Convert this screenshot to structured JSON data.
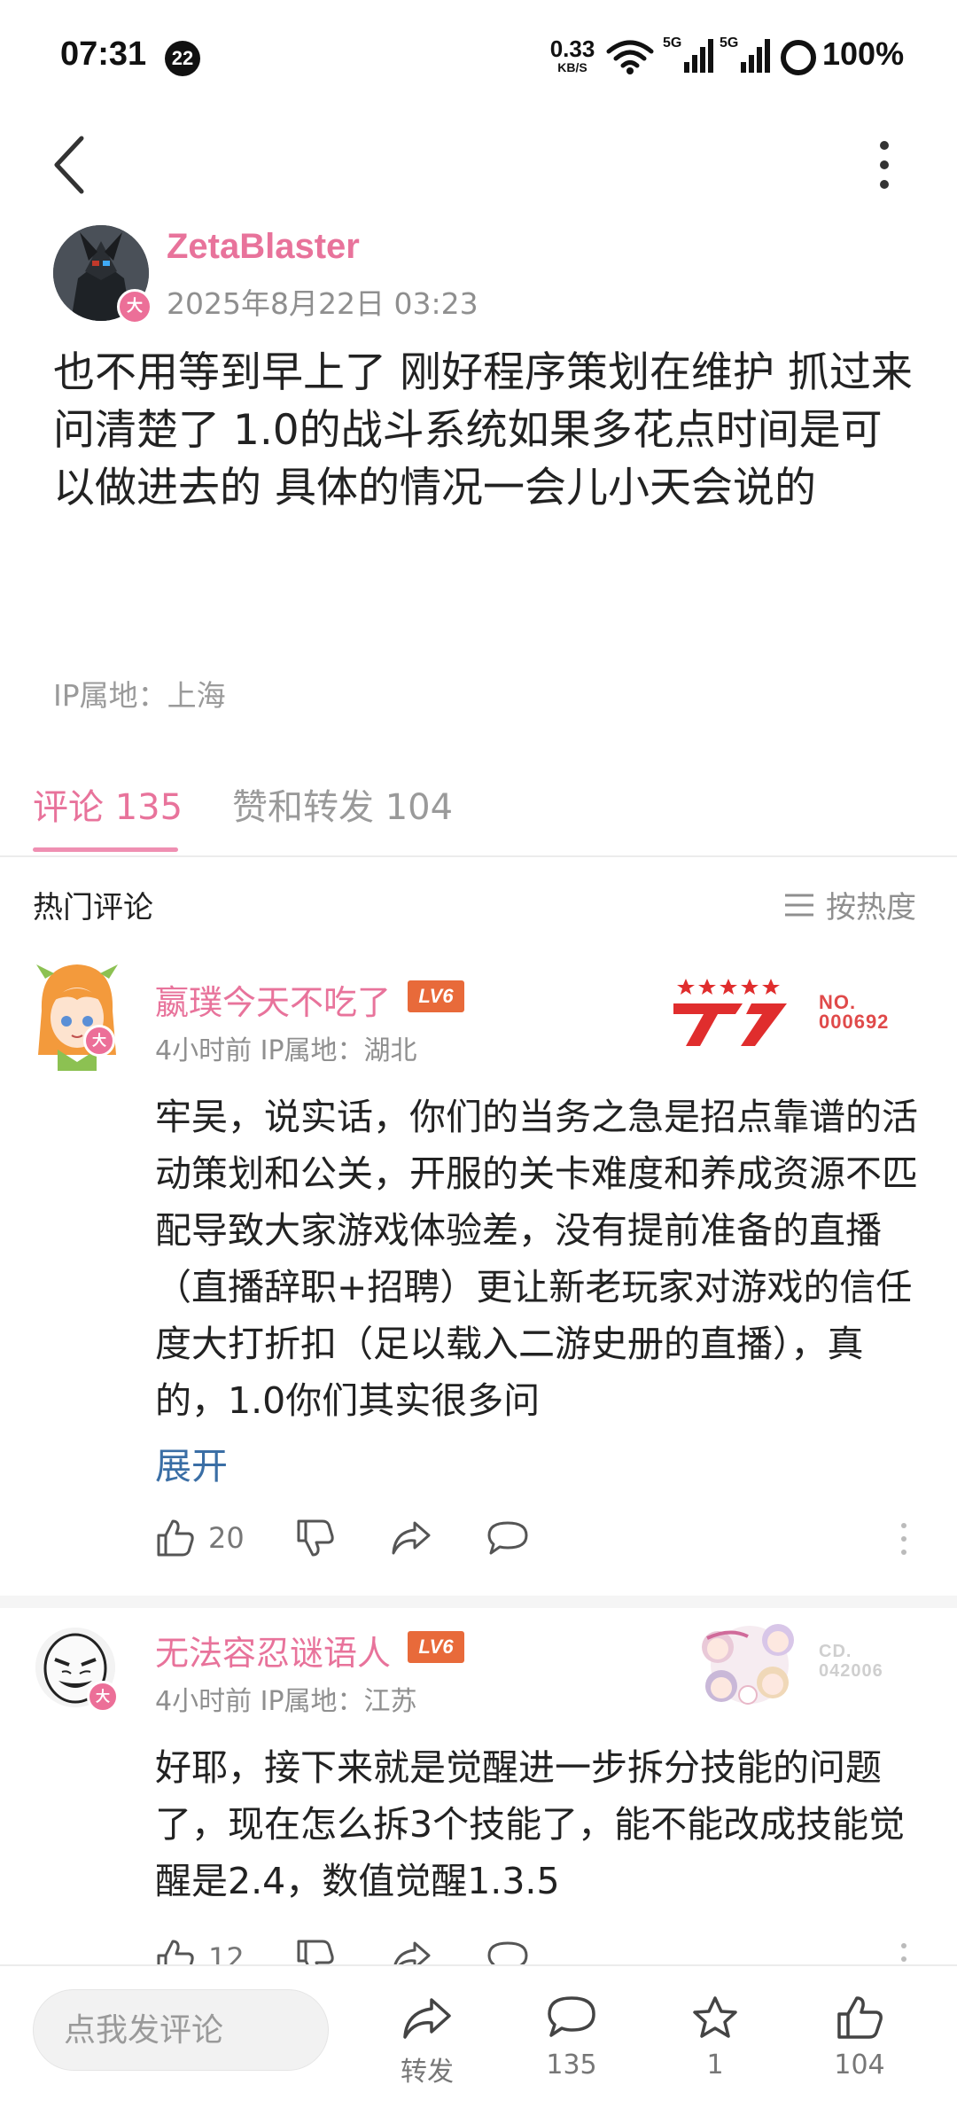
{
  "status_bar": {
    "time": "07:31",
    "notification_count": "22",
    "net_speed_value": "0.33",
    "net_speed_unit": "KB/S",
    "signal_label_1": "5G",
    "signal_label_2": "5G",
    "battery": "100%"
  },
  "post": {
    "author": "ZetaBlaster",
    "level_char": "大",
    "time": "2025年8月22日 03:23",
    "body": "也不用等到早上了 刚好程序策划在维护 抓过来问清楚了 1.0的战斗系统如果多花点时间是可以做进去的 具体的情况一会儿小天会说的",
    "ip": "IP属地：上海"
  },
  "tabs": [
    {
      "label": "评论 135",
      "active": true
    },
    {
      "label": "赞和转发 104",
      "active": false
    }
  ],
  "comments_header": {
    "title": "热门评论",
    "sort_label": "按热度"
  },
  "comments": [
    {
      "name": "嬴璞今天不吃了",
      "level_tag": "LV6",
      "level_char": "大",
      "meta": "4小时前 IP属地：湖北",
      "badge_label": "NO.",
      "badge_number": "000692",
      "body": "牢吴，说实话，你们的当务之急是招点靠谱的活动策划和公关，开服的关卡难度和养成资源不匹配导致大家游戏体验差，没有提前准备的直播（直播辞职+招聘）更让新老玩家对游戏的信任度大打折扣（足以载入二游史册的直播），真的，1.0你们其实很多问",
      "expand_label": "展开",
      "likes": "20"
    },
    {
      "name": "无法容忍谜语人",
      "level_tag": "LV6",
      "level_char": "大",
      "meta": "4小时前 IP属地：江苏",
      "badge_label": "CD.",
      "badge_number": "042006",
      "body": "好耶，接下来就是觉醒进一步拆分技能的问题了，现在怎么拆3个技能了，能不能改成技能觉醒是2.4，数值觉醒1.3.5",
      "likes": "12"
    }
  ],
  "bottom_bar": {
    "input_placeholder": "点我发评论",
    "repost_label": "转发",
    "comments_count": "135",
    "favorites_count": "1",
    "likes_count": "104"
  },
  "colors": {
    "accent_pink": "#e8739b",
    "link_blue": "#3a6ea5",
    "level_orange": "#e86a3a"
  }
}
